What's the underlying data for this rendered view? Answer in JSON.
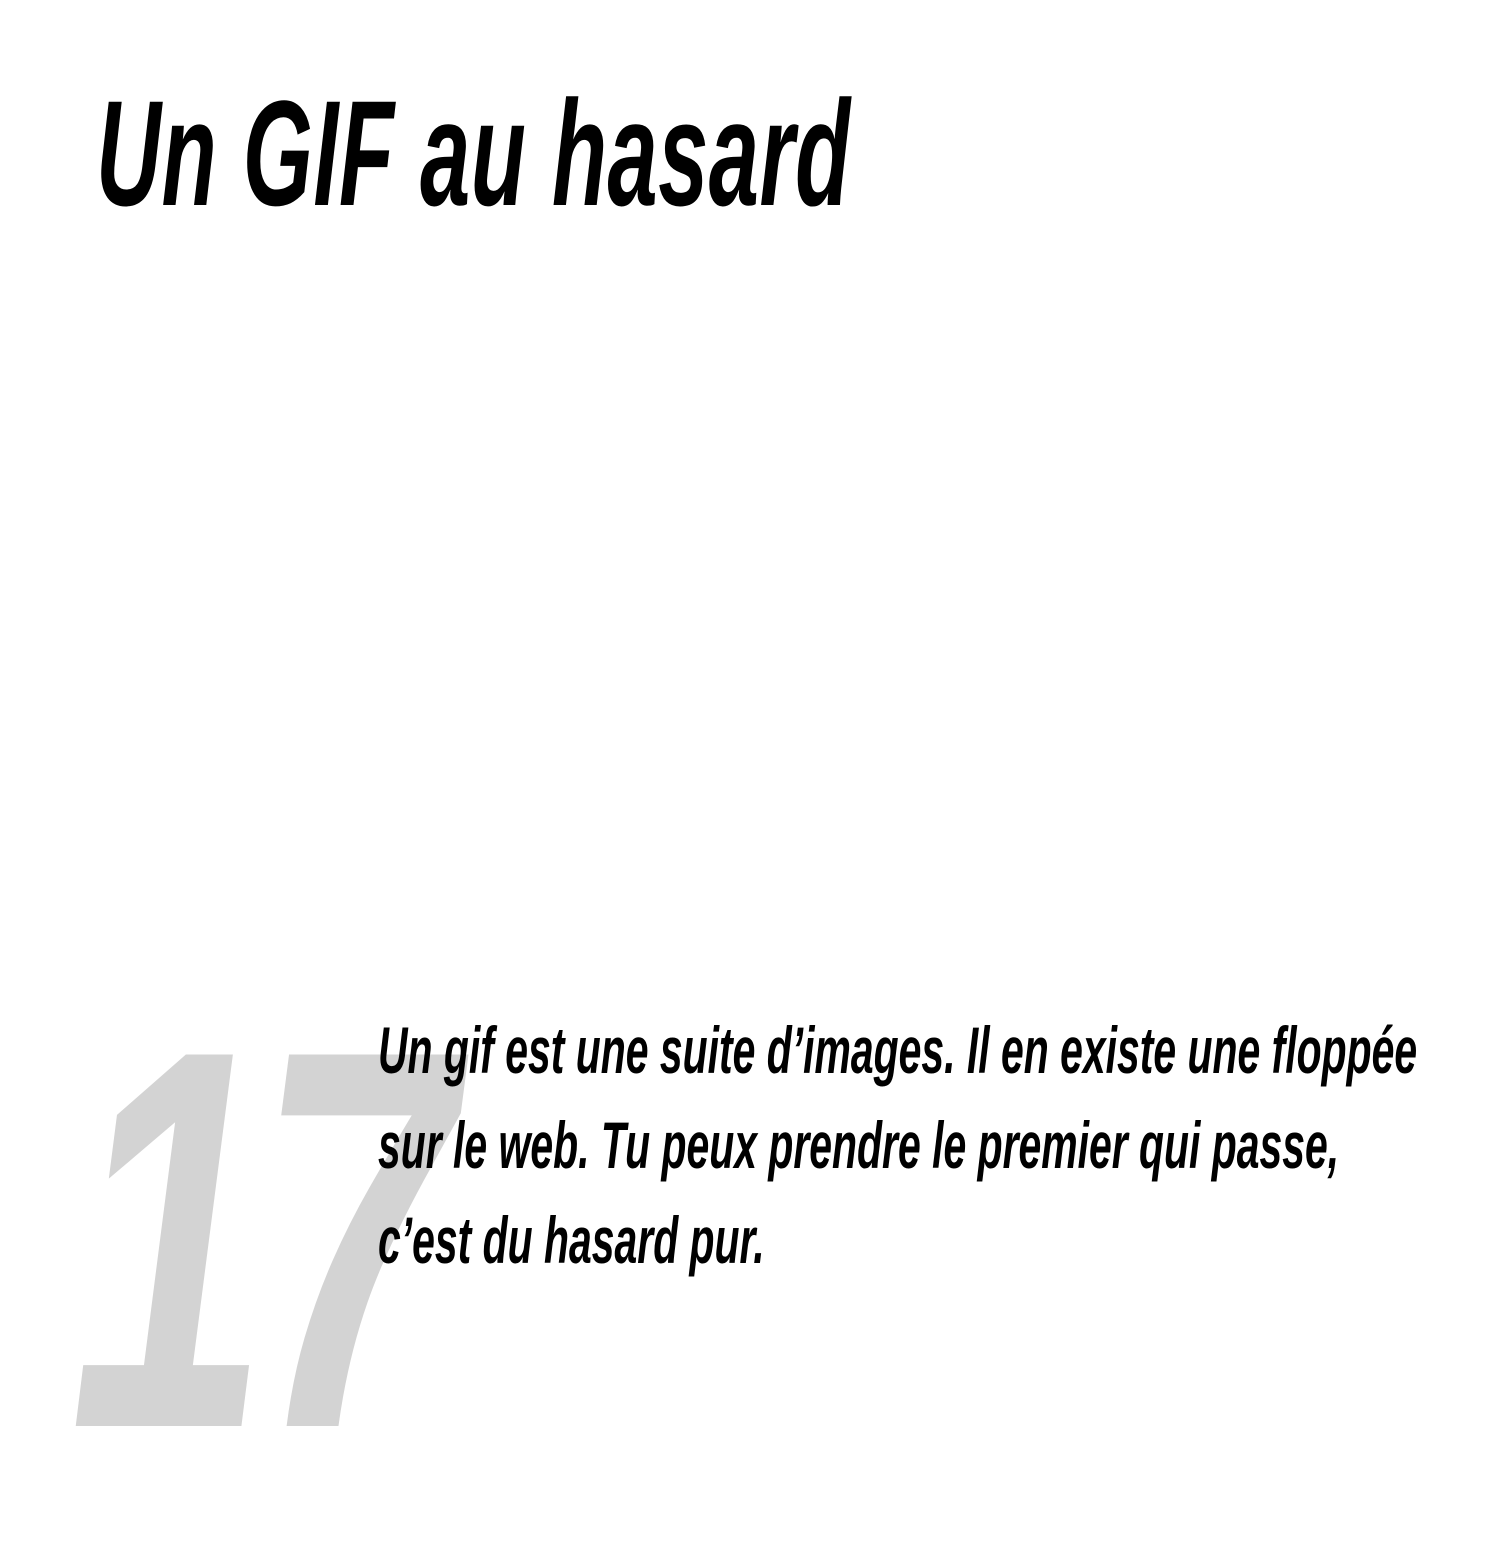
{
  "title": "Un GIF au hasard",
  "number": "17",
  "body": "Un gif est une suite d’images. Il en existe une floppée sur le web. Tu peux prendre le premier qui passe, c’est du hasard pur.",
  "colors": {
    "text": "#000000",
    "number": "#d3d3d3",
    "background": "#ffffff"
  }
}
